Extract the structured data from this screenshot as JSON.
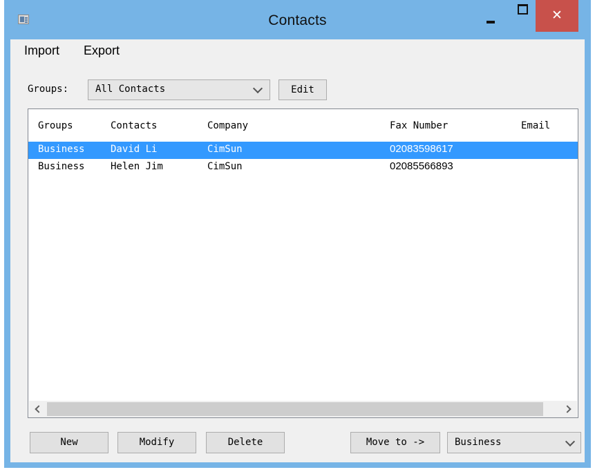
{
  "window": {
    "title": "Contacts",
    "close_glyph": "✕",
    "titlebar_color": "#76b4e6",
    "close_color": "#c8514b"
  },
  "menu": [
    "Import",
    "Export"
  ],
  "groups_filter": {
    "label": "Groups:",
    "selected": "All Contacts",
    "edit_label": "Edit"
  },
  "table": {
    "columns": [
      "Groups",
      "Contacts",
      "Company",
      "Fax Number",
      "Email"
    ],
    "rows": [
      {
        "group": "Business",
        "contact": "David Li",
        "company": "CimSun",
        "fax": "02083598617",
        "email": "",
        "selected": true
      },
      {
        "group": "Business",
        "contact": "Helen Jim",
        "company": "CimSun",
        "fax": "02085566893",
        "email": "",
        "selected": false
      }
    ],
    "selection_color": "#3399ff"
  },
  "buttons": {
    "new": "New",
    "modify": "Modify",
    "delete": "Delete",
    "move_to": "Move to ->"
  },
  "move_target": {
    "selected": "Business"
  }
}
